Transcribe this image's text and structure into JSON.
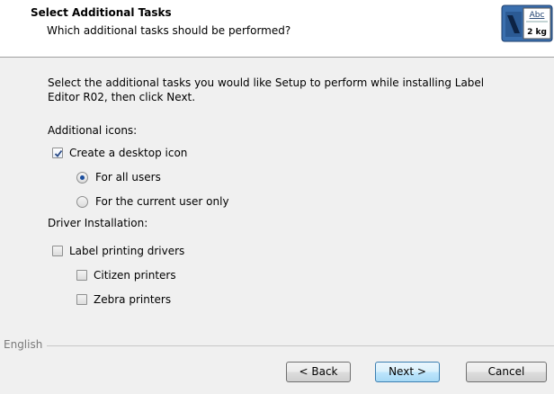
{
  "header": {
    "title": "Select Additional Tasks",
    "subtitle": "Which additional tasks should be performed?",
    "logo": {
      "icon": "label-box-icon",
      "text_top": "Abc",
      "text_bottom": "2 kg"
    }
  },
  "intro_text": "Select the additional tasks you would like Setup to perform while installing Label Editor R02, then click Next.",
  "sections": {
    "icons_label": "Additional icons:",
    "desktop_icon": {
      "label": "Create a desktop icon",
      "checked": true
    },
    "all_users": {
      "label": "For all users",
      "selected": true
    },
    "current_user": {
      "label": "For the current user only",
      "selected": false
    },
    "driver_label": "Driver Installation:",
    "label_drivers": {
      "label": "Label printing drivers",
      "checked": false
    },
    "citizen": {
      "label": "Citizen printers",
      "checked": false
    },
    "zebra": {
      "label": "Zebra printers",
      "checked": false
    }
  },
  "footer": {
    "language": "English",
    "back_label": "< Back",
    "next_label": "Next >",
    "cancel_label": "Cancel"
  }
}
